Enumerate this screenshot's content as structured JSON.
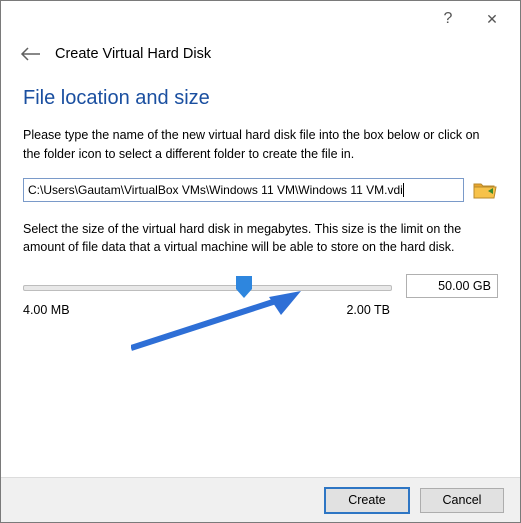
{
  "titlebar": {
    "help_icon": "?",
    "close_icon": "✕"
  },
  "header": {
    "back_icon": "←",
    "title": "Create Virtual Hard Disk"
  },
  "section_title": "File location and size",
  "location_help": "Please type the name of the new virtual hard disk file into the box below or click on the folder icon to select a different folder to create the file in.",
  "file_path": "C:\\Users\\Gautam\\VirtualBox VMs\\Windows 11 VM\\Windows 11 VM.vdi",
  "size_help": "Select the size of the virtual hard disk in megabytes. This size is the limit on the amount of file data that a virtual machine will be able to store on the hard disk.",
  "slider": {
    "min_label": "4.00 MB",
    "max_label": "2.00 TB",
    "value_label": "50.00 GB"
  },
  "buttons": {
    "create": "Create",
    "cancel": "Cancel"
  }
}
